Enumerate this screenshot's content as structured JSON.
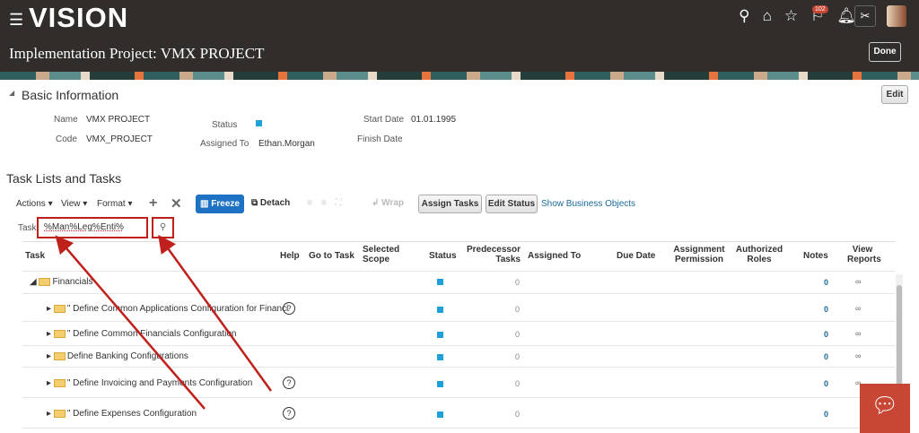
{
  "header": {
    "logo": "VISION",
    "notification_count": "102",
    "page_title": "Implementation Project: VMX PROJECT",
    "done_label": "Done"
  },
  "basic": {
    "title": "Basic Information",
    "edit_label": "Edit",
    "name_label": "Name",
    "name": "VMX PROJECT",
    "code_label": "Code",
    "code": "VMX_PROJECT",
    "status_label": "Status",
    "assigned_label": "Assigned To",
    "assigned": "Ethan.Morgan",
    "start_label": "Start Date",
    "start": "01.01.1995",
    "finish_label": "Finish Date"
  },
  "tasks": {
    "title": "Task Lists and Tasks",
    "actions": "Actions",
    "view": "View",
    "format": "Format",
    "freeze": "Freeze",
    "detach": "Detach",
    "wrap": "Wrap",
    "assign": "Assign Tasks",
    "edit_status": "Edit Status",
    "show_bo": "Show Business Objects",
    "task_label": "Task",
    "task_value": "%Man%Leg%Enti%"
  },
  "columns": [
    "Task",
    "Help",
    "Go to Task",
    "Selected Scope",
    "Status",
    "Predecessor Tasks",
    "Assigned To",
    "Due Date",
    "Assignment Permission",
    "Authorized Roles",
    "Notes",
    "View Reports"
  ],
  "rows": [
    {
      "name": "Financials",
      "pred": "0",
      "notes": "0"
    },
    {
      "name": "Define Common Applications Configuration for Financi",
      "pred": "0",
      "notes": "0"
    },
    {
      "name": "Define Common Financials Configuration",
      "pred": "0",
      "notes": "0"
    },
    {
      "name": "Define Banking Configurations",
      "pred": "0",
      "notes": "0"
    },
    {
      "name": "Define Invoicing and Payments Configuration",
      "pred": "0",
      "notes": "0"
    },
    {
      "name": "Define Expenses Configuration",
      "pred": "0",
      "notes": "0"
    }
  ],
  "colors": {
    "header": "#312d2a",
    "accent": "#1ea0d8",
    "annotation": "#c0201b"
  }
}
